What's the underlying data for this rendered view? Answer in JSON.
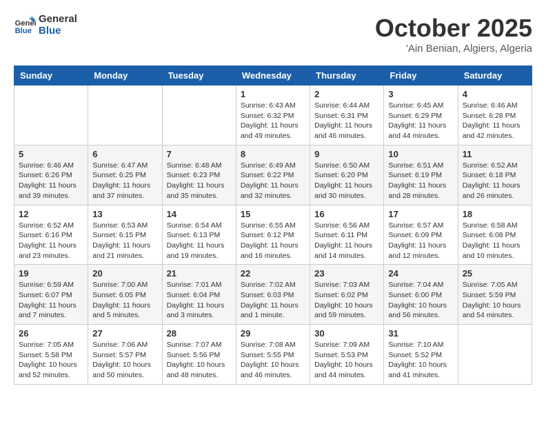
{
  "logo": {
    "line1": "General",
    "line2": "Blue"
  },
  "title": "October 2025",
  "subtitle": "'Ain Benian, Algiers, Algeria",
  "weekdays": [
    "Sunday",
    "Monday",
    "Tuesday",
    "Wednesday",
    "Thursday",
    "Friday",
    "Saturday"
  ],
  "weeks": [
    [
      {
        "day": "",
        "info": ""
      },
      {
        "day": "",
        "info": ""
      },
      {
        "day": "",
        "info": ""
      },
      {
        "day": "1",
        "info": "Sunrise: 6:43 AM\nSunset: 6:32 PM\nDaylight: 11 hours\nand 49 minutes."
      },
      {
        "day": "2",
        "info": "Sunrise: 6:44 AM\nSunset: 6:31 PM\nDaylight: 11 hours\nand 46 minutes."
      },
      {
        "day": "3",
        "info": "Sunrise: 6:45 AM\nSunset: 6:29 PM\nDaylight: 11 hours\nand 44 minutes."
      },
      {
        "day": "4",
        "info": "Sunrise: 6:46 AM\nSunset: 6:28 PM\nDaylight: 11 hours\nand 42 minutes."
      }
    ],
    [
      {
        "day": "5",
        "info": "Sunrise: 6:46 AM\nSunset: 6:26 PM\nDaylight: 11 hours\nand 39 minutes."
      },
      {
        "day": "6",
        "info": "Sunrise: 6:47 AM\nSunset: 6:25 PM\nDaylight: 11 hours\nand 37 minutes."
      },
      {
        "day": "7",
        "info": "Sunrise: 6:48 AM\nSunset: 6:23 PM\nDaylight: 11 hours\nand 35 minutes."
      },
      {
        "day": "8",
        "info": "Sunrise: 6:49 AM\nSunset: 6:22 PM\nDaylight: 11 hours\nand 32 minutes."
      },
      {
        "day": "9",
        "info": "Sunrise: 6:50 AM\nSunset: 6:20 PM\nDaylight: 11 hours\nand 30 minutes."
      },
      {
        "day": "10",
        "info": "Sunrise: 6:51 AM\nSunset: 6:19 PM\nDaylight: 11 hours\nand 28 minutes."
      },
      {
        "day": "11",
        "info": "Sunrise: 6:52 AM\nSunset: 6:18 PM\nDaylight: 11 hours\nand 26 minutes."
      }
    ],
    [
      {
        "day": "12",
        "info": "Sunrise: 6:52 AM\nSunset: 6:16 PM\nDaylight: 11 hours\nand 23 minutes."
      },
      {
        "day": "13",
        "info": "Sunrise: 6:53 AM\nSunset: 6:15 PM\nDaylight: 11 hours\nand 21 minutes."
      },
      {
        "day": "14",
        "info": "Sunrise: 6:54 AM\nSunset: 6:13 PM\nDaylight: 11 hours\nand 19 minutes."
      },
      {
        "day": "15",
        "info": "Sunrise: 6:55 AM\nSunset: 6:12 PM\nDaylight: 11 hours\nand 16 minutes."
      },
      {
        "day": "16",
        "info": "Sunrise: 6:56 AM\nSunset: 6:11 PM\nDaylight: 11 hours\nand 14 minutes."
      },
      {
        "day": "17",
        "info": "Sunrise: 6:57 AM\nSunset: 6:09 PM\nDaylight: 11 hours\nand 12 minutes."
      },
      {
        "day": "18",
        "info": "Sunrise: 6:58 AM\nSunset: 6:08 PM\nDaylight: 11 hours\nand 10 minutes."
      }
    ],
    [
      {
        "day": "19",
        "info": "Sunrise: 6:59 AM\nSunset: 6:07 PM\nDaylight: 11 hours\nand 7 minutes."
      },
      {
        "day": "20",
        "info": "Sunrise: 7:00 AM\nSunset: 6:05 PM\nDaylight: 11 hours\nand 5 minutes."
      },
      {
        "day": "21",
        "info": "Sunrise: 7:01 AM\nSunset: 6:04 PM\nDaylight: 11 hours\nand 3 minutes."
      },
      {
        "day": "22",
        "info": "Sunrise: 7:02 AM\nSunset: 6:03 PM\nDaylight: 11 hours\nand 1 minute."
      },
      {
        "day": "23",
        "info": "Sunrise: 7:03 AM\nSunset: 6:02 PM\nDaylight: 10 hours\nand 59 minutes."
      },
      {
        "day": "24",
        "info": "Sunrise: 7:04 AM\nSunset: 6:00 PM\nDaylight: 10 hours\nand 56 minutes."
      },
      {
        "day": "25",
        "info": "Sunrise: 7:05 AM\nSunset: 5:59 PM\nDaylight: 10 hours\nand 54 minutes."
      }
    ],
    [
      {
        "day": "26",
        "info": "Sunrise: 7:05 AM\nSunset: 5:58 PM\nDaylight: 10 hours\nand 52 minutes."
      },
      {
        "day": "27",
        "info": "Sunrise: 7:06 AM\nSunset: 5:57 PM\nDaylight: 10 hours\nand 50 minutes."
      },
      {
        "day": "28",
        "info": "Sunrise: 7:07 AM\nSunset: 5:56 PM\nDaylight: 10 hours\nand 48 minutes."
      },
      {
        "day": "29",
        "info": "Sunrise: 7:08 AM\nSunset: 5:55 PM\nDaylight: 10 hours\nand 46 minutes."
      },
      {
        "day": "30",
        "info": "Sunrise: 7:09 AM\nSunset: 5:53 PM\nDaylight: 10 hours\nand 44 minutes."
      },
      {
        "day": "31",
        "info": "Sunrise: 7:10 AM\nSunset: 5:52 PM\nDaylight: 10 hours\nand 41 minutes."
      },
      {
        "day": "",
        "info": ""
      }
    ]
  ]
}
